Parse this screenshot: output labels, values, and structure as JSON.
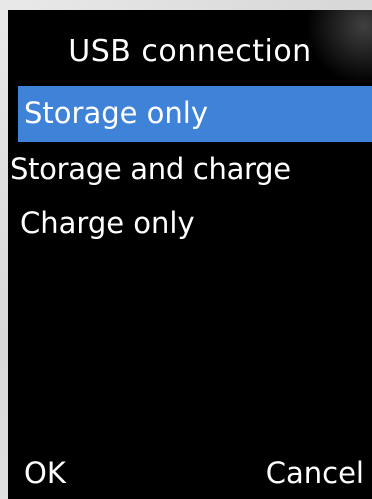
{
  "screen": {
    "title": "USB connection"
  },
  "menu": {
    "items": [
      {
        "label": "Storage only",
        "selected": true
      },
      {
        "label": "Storage and charge",
        "selected": false
      },
      {
        "label": "Charge only",
        "selected": false
      }
    ]
  },
  "softkeys": {
    "left": "OK",
    "right": "Cancel"
  },
  "colors": {
    "background": "#000000",
    "selection": "#3f83d8",
    "text": "#ffffff"
  }
}
